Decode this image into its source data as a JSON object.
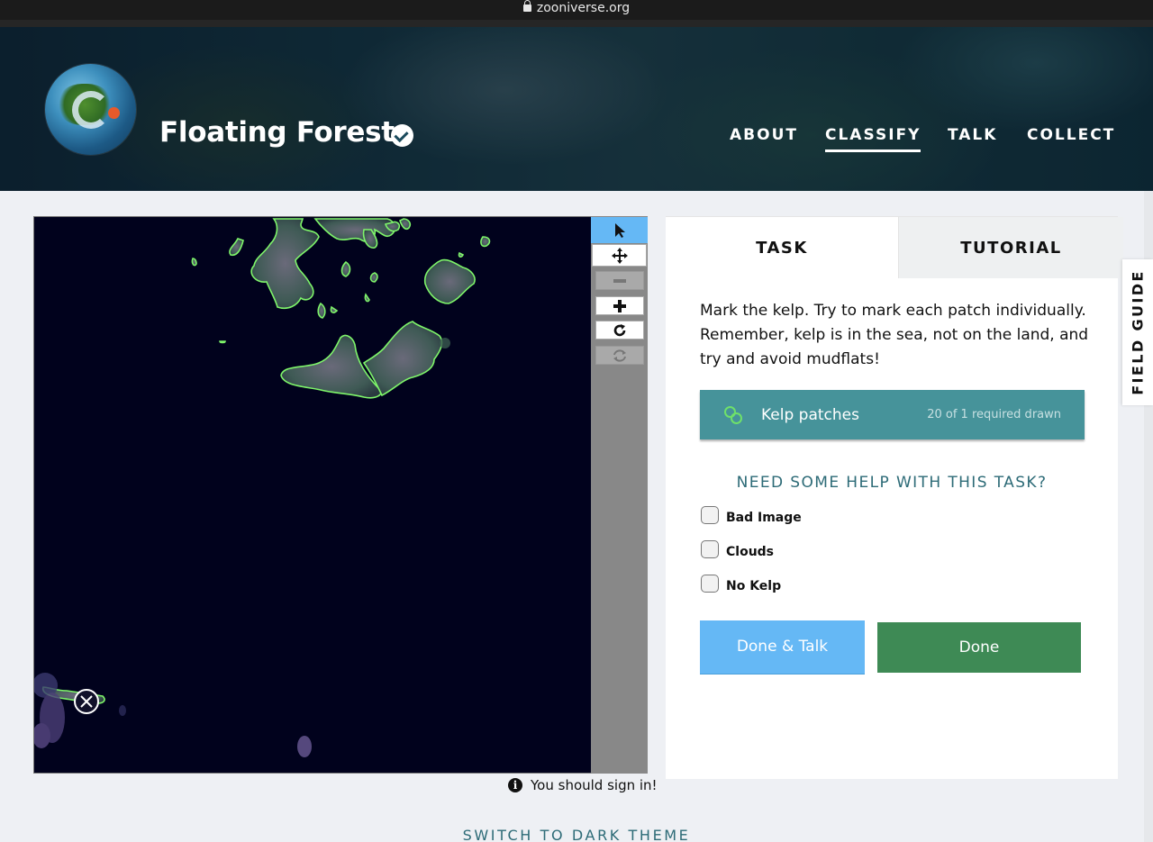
{
  "browser": {
    "url": "zooniverse.org"
  },
  "header": {
    "project_title": "Floating Forests",
    "nav": [
      {
        "label": "ABOUT",
        "active": false
      },
      {
        "label": "CLASSIFY",
        "active": true
      },
      {
        "label": "TALK",
        "active": false
      },
      {
        "label": "COLLECT",
        "active": false
      }
    ]
  },
  "viewer": {
    "tools": [
      "pointer-icon",
      "move-icon",
      "zoom-out-icon",
      "zoom-in-icon",
      "rotate-icon",
      "reset-icon"
    ],
    "selected_tool": "pointer-icon",
    "sign_in_notice": "You should sign in!"
  },
  "panel": {
    "tabs": [
      {
        "label": "TASK",
        "active": true
      },
      {
        "label": "TUTORIAL",
        "active": false
      }
    ],
    "instructions": "Mark the kelp. Try to mark each patch individually. Remember, kelp is in the sea, not on the land, and try and avoid mudflats!",
    "tool_button": {
      "label": "Kelp patches",
      "count_text": "20 of 1 required drawn"
    },
    "help_heading": "NEED SOME HELP WITH THIS TASK?",
    "checkboxes": [
      {
        "label": "Bad Image",
        "checked": false
      },
      {
        "label": "Clouds",
        "checked": false
      },
      {
        "label": "No Kelp",
        "checked": false
      }
    ],
    "done_talk_label": "Done & Talk",
    "done_label": "Done"
  },
  "field_guide_label": "FIELD GUIDE",
  "footer": {
    "dark_theme_label": "SWITCH TO DARK THEME"
  },
  "colors": {
    "accent_teal": "#46939a",
    "done_green": "#3e8a55",
    "talk_blue": "#65b8f5",
    "kelp_outline": "#7ef56a"
  }
}
